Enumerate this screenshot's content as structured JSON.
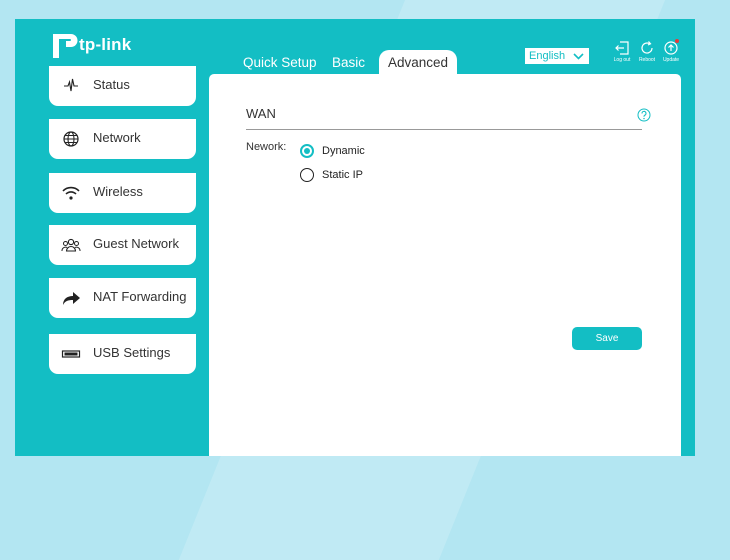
{
  "brand": {
    "logo_text": "tp-link"
  },
  "tabs": [
    {
      "label": "Quick Setup"
    },
    {
      "label": "Basic"
    },
    {
      "label": "Advanced",
      "active": true
    }
  ],
  "header": {
    "language": "English",
    "logout_label": "Log out",
    "reboot_label": "Reboot",
    "update_label": "Update"
  },
  "sidebar": {
    "items": [
      {
        "label": "Status",
        "icon": "pulse-icon"
      },
      {
        "label": "Network",
        "icon": "globe-icon"
      },
      {
        "label": "Wireless",
        "icon": "wifi-icon"
      },
      {
        "label": "Guest Network",
        "icon": "users-icon"
      },
      {
        "label": "NAT Forwarding",
        "icon": "forward-arrow-icon"
      },
      {
        "label": "USB Settings",
        "icon": "usb-icon"
      }
    ]
  },
  "main": {
    "section_title": "WAN",
    "network_label": "Nework:",
    "options": [
      {
        "label": "Dynamic",
        "selected": true
      },
      {
        "label": "Static IP",
        "selected": false
      }
    ],
    "save_label": "Save"
  },
  "colors": {
    "accent": "#13bec4",
    "background": "#b3e6f2",
    "panel": "#ffffff",
    "text": "#333333",
    "badge": "#e63a3a"
  }
}
